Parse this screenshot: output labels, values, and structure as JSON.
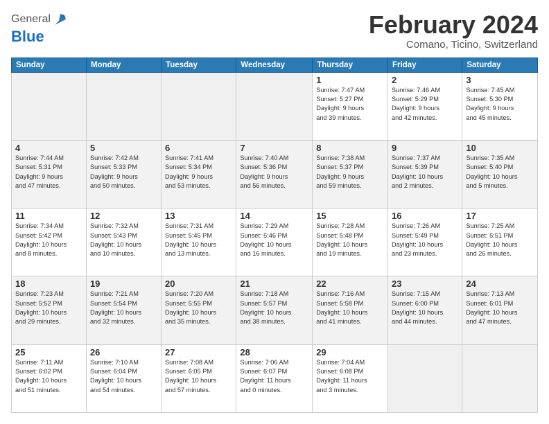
{
  "logo": {
    "line1": "General",
    "line2": "Blue"
  },
  "header": {
    "month": "February 2024",
    "location": "Comano, Ticino, Switzerland"
  },
  "weekdays": [
    "Sunday",
    "Monday",
    "Tuesday",
    "Wednesday",
    "Thursday",
    "Friday",
    "Saturday"
  ],
  "weeks": [
    [
      {
        "day": "",
        "info": ""
      },
      {
        "day": "",
        "info": ""
      },
      {
        "day": "",
        "info": ""
      },
      {
        "day": "",
        "info": ""
      },
      {
        "day": "1",
        "info": "Sunrise: 7:47 AM\nSunset: 5:27 PM\nDaylight: 9 hours\nand 39 minutes."
      },
      {
        "day": "2",
        "info": "Sunrise: 7:46 AM\nSunset: 5:29 PM\nDaylight: 9 hours\nand 42 minutes."
      },
      {
        "day": "3",
        "info": "Sunrise: 7:45 AM\nSunset: 5:30 PM\nDaylight: 9 hours\nand 45 minutes."
      }
    ],
    [
      {
        "day": "4",
        "info": "Sunrise: 7:44 AM\nSunset: 5:31 PM\nDaylight: 9 hours\nand 47 minutes."
      },
      {
        "day": "5",
        "info": "Sunrise: 7:42 AM\nSunset: 5:33 PM\nDaylight: 9 hours\nand 50 minutes."
      },
      {
        "day": "6",
        "info": "Sunrise: 7:41 AM\nSunset: 5:34 PM\nDaylight: 9 hours\nand 53 minutes."
      },
      {
        "day": "7",
        "info": "Sunrise: 7:40 AM\nSunset: 5:36 PM\nDaylight: 9 hours\nand 56 minutes."
      },
      {
        "day": "8",
        "info": "Sunrise: 7:38 AM\nSunset: 5:37 PM\nDaylight: 9 hours\nand 59 minutes."
      },
      {
        "day": "9",
        "info": "Sunrise: 7:37 AM\nSunset: 5:39 PM\nDaylight: 10 hours\nand 2 minutes."
      },
      {
        "day": "10",
        "info": "Sunrise: 7:35 AM\nSunset: 5:40 PM\nDaylight: 10 hours\nand 5 minutes."
      }
    ],
    [
      {
        "day": "11",
        "info": "Sunrise: 7:34 AM\nSunset: 5:42 PM\nDaylight: 10 hours\nand 8 minutes."
      },
      {
        "day": "12",
        "info": "Sunrise: 7:32 AM\nSunset: 5:43 PM\nDaylight: 10 hours\nand 10 minutes."
      },
      {
        "day": "13",
        "info": "Sunrise: 7:31 AM\nSunset: 5:45 PM\nDaylight: 10 hours\nand 13 minutes."
      },
      {
        "day": "14",
        "info": "Sunrise: 7:29 AM\nSunset: 5:46 PM\nDaylight: 10 hours\nand 16 minutes."
      },
      {
        "day": "15",
        "info": "Sunrise: 7:28 AM\nSunset: 5:48 PM\nDaylight: 10 hours\nand 19 minutes."
      },
      {
        "day": "16",
        "info": "Sunrise: 7:26 AM\nSunset: 5:49 PM\nDaylight: 10 hours\nand 23 minutes."
      },
      {
        "day": "17",
        "info": "Sunrise: 7:25 AM\nSunset: 5:51 PM\nDaylight: 10 hours\nand 26 minutes."
      }
    ],
    [
      {
        "day": "18",
        "info": "Sunrise: 7:23 AM\nSunset: 5:52 PM\nDaylight: 10 hours\nand 29 minutes."
      },
      {
        "day": "19",
        "info": "Sunrise: 7:21 AM\nSunset: 5:54 PM\nDaylight: 10 hours\nand 32 minutes."
      },
      {
        "day": "20",
        "info": "Sunrise: 7:20 AM\nSunset: 5:55 PM\nDaylight: 10 hours\nand 35 minutes."
      },
      {
        "day": "21",
        "info": "Sunrise: 7:18 AM\nSunset: 5:57 PM\nDaylight: 10 hours\nand 38 minutes."
      },
      {
        "day": "22",
        "info": "Sunrise: 7:16 AM\nSunset: 5:58 PM\nDaylight: 10 hours\nand 41 minutes."
      },
      {
        "day": "23",
        "info": "Sunrise: 7:15 AM\nSunset: 6:00 PM\nDaylight: 10 hours\nand 44 minutes."
      },
      {
        "day": "24",
        "info": "Sunrise: 7:13 AM\nSunset: 6:01 PM\nDaylight: 10 hours\nand 47 minutes."
      }
    ],
    [
      {
        "day": "25",
        "info": "Sunrise: 7:11 AM\nSunset: 6:02 PM\nDaylight: 10 hours\nand 51 minutes."
      },
      {
        "day": "26",
        "info": "Sunrise: 7:10 AM\nSunset: 6:04 PM\nDaylight: 10 hours\nand 54 minutes."
      },
      {
        "day": "27",
        "info": "Sunrise: 7:08 AM\nSunset: 6:05 PM\nDaylight: 10 hours\nand 57 minutes."
      },
      {
        "day": "28",
        "info": "Sunrise: 7:06 AM\nSunset: 6:07 PM\nDaylight: 11 hours\nand 0 minutes."
      },
      {
        "day": "29",
        "info": "Sunrise: 7:04 AM\nSunset: 6:08 PM\nDaylight: 11 hours\nand 3 minutes."
      },
      {
        "day": "",
        "info": ""
      },
      {
        "day": "",
        "info": ""
      }
    ]
  ]
}
